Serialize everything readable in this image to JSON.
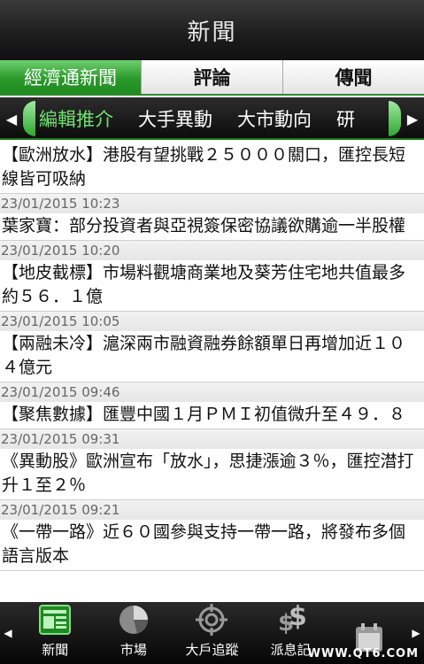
{
  "titlebar": {
    "title": "新聞"
  },
  "main_tabs": [
    {
      "label": "經濟通新聞",
      "active": true
    },
    {
      "label": "評論",
      "active": false
    },
    {
      "label": "傳聞",
      "active": false
    }
  ],
  "categories": [
    {
      "label": "編輯推介",
      "active": true
    },
    {
      "label": "大手異動",
      "active": false
    },
    {
      "label": "大市動向",
      "active": false
    },
    {
      "label": "研",
      "active": false
    }
  ],
  "news": [
    {
      "time": "",
      "title": "【歐洲放水】港股有望挑戰２５０００關口，匯控長短線皆可吸納"
    },
    {
      "time": "23/01/2015 10:23",
      "title": "葉家寶：部分投資者與亞視簽保密協議欲購逾一半股權"
    },
    {
      "time": "23/01/2015 10:20",
      "title": "【地皮截標】市場料觀塘商業地及葵芳住宅地共值最多約５６．１億"
    },
    {
      "time": "23/01/2015 10:05",
      "title": "【兩融未冷】滬深兩市融資融券餘額單日再增加近１０４億元"
    },
    {
      "time": "23/01/2015 09:46",
      "title": "【聚焦數據】匯豐中國１月ＰＭＩ初值微升至４９．８"
    },
    {
      "time": "23/01/2015 09:31",
      "title": "《異動股》歐洲宣布「放水」，思捷漲逾３％，匯控澘打升１至２％"
    },
    {
      "time": "23/01/2015 09:21",
      "title": "《一帶一路》近６０國參與支持一帶一路，將發布多個語言版本"
    }
  ],
  "bottom_nav": [
    {
      "label": "新聞",
      "icon": "news-icon",
      "active": true
    },
    {
      "label": "市場",
      "icon": "market-pie-icon",
      "active": false
    },
    {
      "label": "大戶追蹤",
      "icon": "target-icon",
      "active": false
    },
    {
      "label": "派息記",
      "icon": "dollar-icon",
      "active": false
    },
    {
      "label": "",
      "icon": "ipo-calendar-icon",
      "active": false
    }
  ],
  "watermark": "WWW.QT6.COM",
  "colors": {
    "accent": "#2a9a2a",
    "active_category": "#6fe26f"
  }
}
